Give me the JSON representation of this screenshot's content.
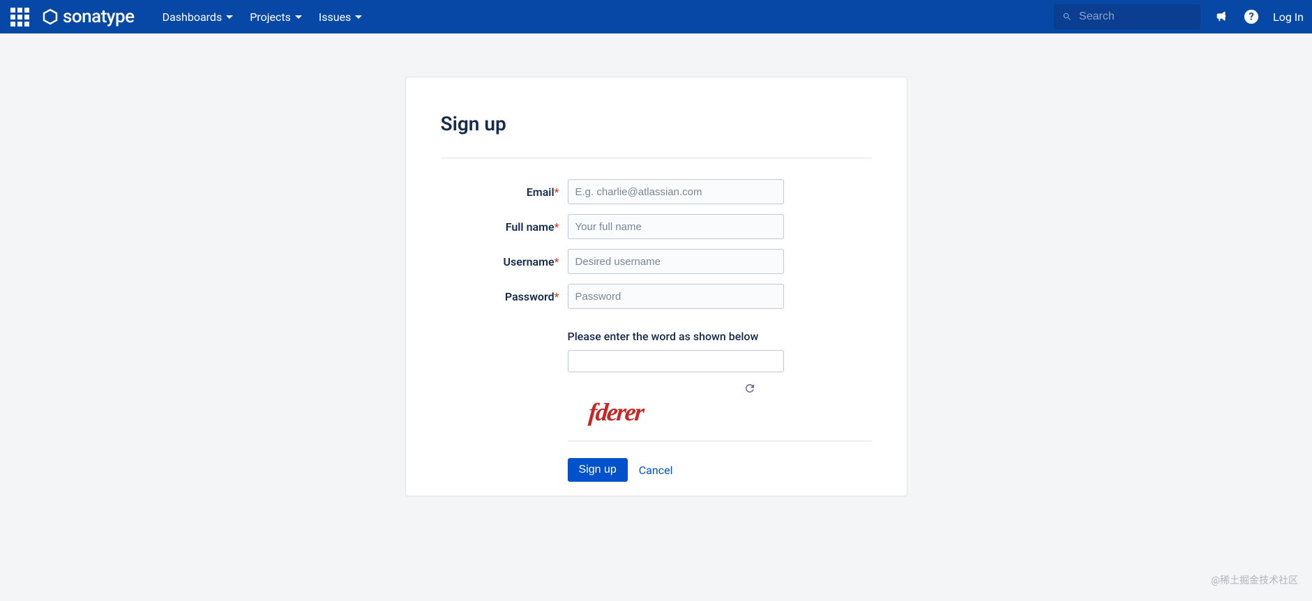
{
  "navbar": {
    "logo_text": "sonatype",
    "items": [
      {
        "label": "Dashboards"
      },
      {
        "label": "Projects"
      },
      {
        "label": "Issues"
      }
    ],
    "search_placeholder": "Search",
    "login_label": "Log In"
  },
  "form": {
    "title": "Sign up",
    "email": {
      "label": "Email",
      "placeholder": "E.g. charlie@atlassian.com"
    },
    "fullname": {
      "label": "Full name",
      "placeholder": "Your full name"
    },
    "username": {
      "label": "Username",
      "placeholder": "Desired username"
    },
    "password": {
      "label": "Password",
      "placeholder": "Password"
    },
    "captcha": {
      "label": "Please enter the word as shown below",
      "image_text": "fderer"
    },
    "submit_label": "Sign up",
    "cancel_label": "Cancel"
  },
  "watermark": "@稀土掘金技术社区"
}
